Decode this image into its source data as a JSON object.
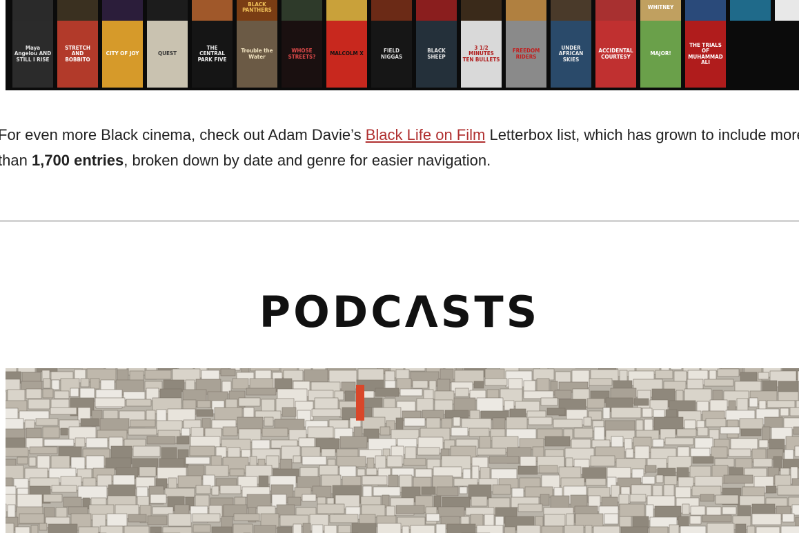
{
  "posters": {
    "top": [
      {
        "label": "",
        "bg": "#2a2a2a",
        "fg": "#ddd"
      },
      {
        "label": "",
        "bg": "#3a3020",
        "fg": "#ddd"
      },
      {
        "label": "",
        "bg": "#2b1d3a",
        "fg": "#ddd"
      },
      {
        "label": "",
        "bg": "#1c1c1c",
        "fg": "#ddd"
      },
      {
        "label": "",
        "bg": "#a0582a",
        "fg": "#ddd"
      },
      {
        "label": "BLACK PANTHERS",
        "bg": "#7a3d14",
        "fg": "#f2c35a"
      },
      {
        "label": "",
        "bg": "#2e3a2a",
        "fg": "#ddd"
      },
      {
        "label": "",
        "bg": "#c9a13a",
        "fg": "#222"
      },
      {
        "label": "",
        "bg": "#6b2a16",
        "fg": "#ddd"
      },
      {
        "label": "",
        "bg": "#8a1e1e",
        "fg": "#ddd"
      },
      {
        "label": "",
        "bg": "#3a2a1a",
        "fg": "#ddd"
      },
      {
        "label": "",
        "bg": "#b08040",
        "fg": "#ddd"
      },
      {
        "label": "",
        "bg": "#4a3a2a",
        "fg": "#ddd"
      },
      {
        "label": "",
        "bg": "#a83030",
        "fg": "#ddd"
      },
      {
        "label": "WHITNEY",
        "bg": "#c0a060",
        "fg": "#fff"
      },
      {
        "label": "",
        "bg": "#2a4a7a",
        "fg": "#ddd"
      },
      {
        "label": "",
        "bg": "#1f6a8a",
        "fg": "#ddd"
      },
      {
        "label": "",
        "bg": "#e8e8e8",
        "fg": "#222"
      },
      {
        "label": "",
        "bg": "#3050a0",
        "fg": "#ddd"
      }
    ],
    "bottom": [
      {
        "label": "Maya Angelou AND STILL I RISE",
        "bg": "#2b2b2b",
        "fg": "#e6e6e6"
      },
      {
        "label": "STRETCH AND BOBBITO",
        "bg": "#b23a2a",
        "fg": "#fff"
      },
      {
        "label": "CITY OF JOY",
        "bg": "#d69a2a",
        "fg": "#fff"
      },
      {
        "label": "QUEST",
        "bg": "#c9c2b0",
        "fg": "#333"
      },
      {
        "label": "THE CENTRAL PARK FIVE",
        "bg": "#151515",
        "fg": "#eee"
      },
      {
        "label": "Trouble the Water",
        "bg": "#6b5a45",
        "fg": "#f1e3c0"
      },
      {
        "label": "WHOSE STREETS?",
        "bg": "#1a1010",
        "fg": "#e04a4a"
      },
      {
        "label": "MALCOLM X",
        "bg": "#c8281e",
        "fg": "#111"
      },
      {
        "label": "FIELD NIGGAS",
        "bg": "#161616",
        "fg": "#ddd"
      },
      {
        "label": "BLACK SHEEP",
        "bg": "#24303a",
        "fg": "#e8e8e8"
      },
      {
        "label": "3 1/2 MINUTES TEN BULLETS",
        "bg": "#d9d9d9",
        "fg": "#b01e1e"
      },
      {
        "label": "FREEDOM RIDERS",
        "bg": "#8a8a8a",
        "fg": "#c02020"
      },
      {
        "label": "UNDER AFRICAN SKIES",
        "bg": "#2a4a6a",
        "fg": "#eee"
      },
      {
        "label": "ACCIDENTAL COURTESY",
        "bg": "#c03030",
        "fg": "#fff"
      },
      {
        "label": "MAJOR!",
        "bg": "#6aa04a",
        "fg": "#fff"
      },
      {
        "label": "THE TRIALS OF MUHAMMAD ALI",
        "bg": "#b01c1c",
        "fg": "#fff"
      }
    ]
  },
  "article": {
    "text_before_link": "For even more Black cinema, check out Adam Davie’s ",
    "link_text": "Black Life on Film",
    "text_after_link": " Letterbox list, which has grown to include more than ",
    "bold_text": "1,700 entries",
    "text_end": ", broken down by date and genre for easier navigation."
  },
  "section": {
    "title": "PODCΛSTS"
  },
  "colors": {
    "link": "#b03030",
    "divider": "#d4d4d4"
  }
}
